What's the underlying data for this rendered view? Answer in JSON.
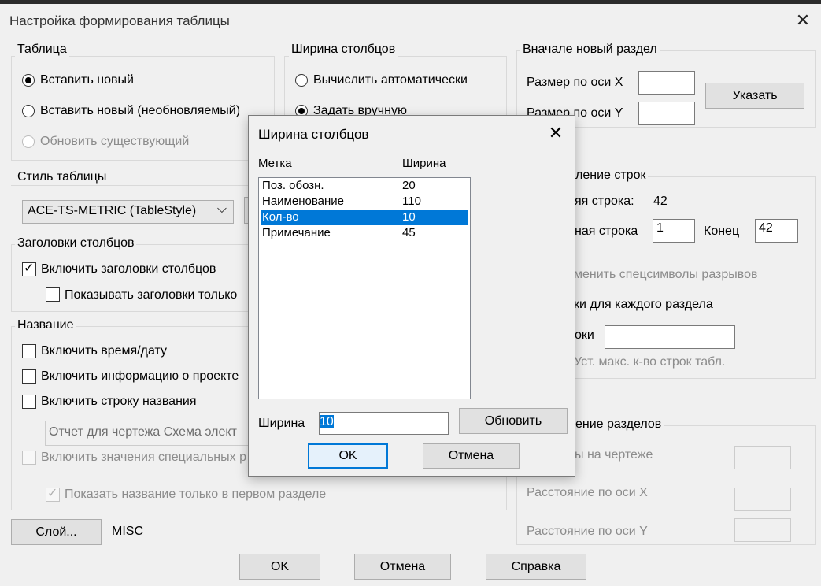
{
  "window": {
    "title": "Настройка формирования таблицы",
    "close_glyph": "✕"
  },
  "table_group": {
    "title": "Таблица",
    "options": [
      {
        "label": "Вставить новый",
        "checked": true,
        "enabled": true
      },
      {
        "label": "Вставить новый (необновляемый)",
        "checked": false,
        "enabled": true
      },
      {
        "label": "Обновить существующий",
        "checked": false,
        "enabled": false
      }
    ]
  },
  "width_group": {
    "title": "Ширина столбцов",
    "options": [
      {
        "label": "Вычислить автоматически",
        "checked": false
      },
      {
        "label": "Задать вручную",
        "checked": true
      }
    ]
  },
  "new_section": {
    "title": "Вначале новый раздел",
    "size_x_label": "Размер по оси X",
    "size_y_label": "Размер по оси Y",
    "size_x_value": "",
    "size_y_value": "",
    "specify_button": "Указать"
  },
  "table_style": {
    "title": "Стиль таблицы",
    "selected": "ACE-TS-METRIC  (TableStyle)"
  },
  "column_headers": {
    "title": "Заголовки столбцов",
    "include_label": "Включить заголовки столбцов",
    "include_checked": true,
    "show_first_label": "Показывать заголовки только",
    "show_first_checked": false
  },
  "name_group": {
    "title": "Название",
    "include_datetime": "Включить время/дату",
    "include_project_info": "Включить информацию о проекте",
    "include_title_row": "Включить строку названия",
    "title_value": "Отчет для чертежа Схема элект",
    "include_special": "Включить значения специальных р",
    "show_title_first": "Показать название только в первом разделе"
  },
  "row_split": {
    "title_partial": "ление строк",
    "last_row_label": "яя строка:",
    "last_row_value": "42",
    "start_row_label": "ная строка",
    "start_row_value": "1",
    "end_label": "Конец",
    "end_value": "42",
    "replace_markers": "менить спецсимволы разрывов",
    "headers_each": "ки для каждого раздела",
    "rows_label": "оки",
    "rows_value": "",
    "max_rows_hint": "Уст. макс. к-во строк табл."
  },
  "section_split": {
    "title_partial": "ение разделов",
    "on_drawing": "ы на чертеже",
    "dist_x": "Расстояние по оси X",
    "dist_y": "Расстояние по оси Y"
  },
  "layer": {
    "button": "Слой...",
    "value": "MISC"
  },
  "footer": {
    "ok": "OK",
    "cancel": "Отмена",
    "help": "Справка"
  },
  "modal": {
    "title": "Ширина столбцов",
    "close_glyph": "✕",
    "col_label_header": "Метка",
    "col_width_header": "Ширина",
    "rows": [
      {
        "label": "Поз. обозн.",
        "width": "20",
        "selected": false
      },
      {
        "label": "Наименование",
        "width": "110",
        "selected": false
      },
      {
        "label": "Кол-во",
        "width": "10",
        "selected": true
      },
      {
        "label": "Примечание",
        "width": "45",
        "selected": false
      }
    ],
    "width_label": "Ширина",
    "width_value": "10",
    "update_button": "Обновить",
    "ok": "OK",
    "cancel": "Отмена"
  }
}
